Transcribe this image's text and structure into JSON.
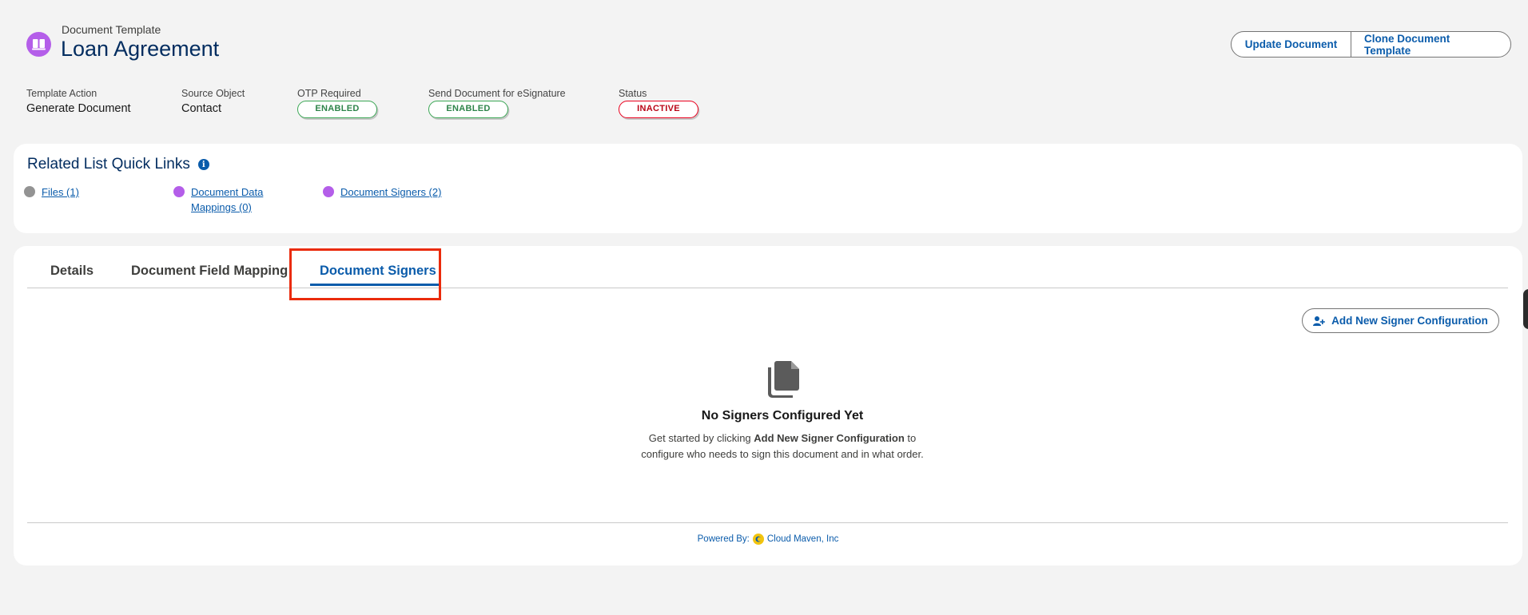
{
  "header": {
    "object_type": "Document Template",
    "title": "Loan Agreement",
    "buttons": {
      "update": "Update Document",
      "clone": "Clone Document Template"
    }
  },
  "fields": [
    {
      "label": "Template Action",
      "value": "Generate Document"
    },
    {
      "label": "Source Object",
      "value": "Contact"
    },
    {
      "label": "OTP Required",
      "badge": "ENABLED"
    },
    {
      "label": "Send Document for eSignature",
      "badge": "ENABLED"
    },
    {
      "label": "Status",
      "badge": "INACTIVE"
    }
  ],
  "quick_links": {
    "title": "Related List Quick Links",
    "links": [
      {
        "label": "Files (1)",
        "icon": "file-icon"
      },
      {
        "label_line1": "Document Data",
        "label_line2": "Mappings (0)",
        "icon": "book-icon"
      },
      {
        "label": "Document Signers (2)",
        "icon": "book-icon"
      }
    ]
  },
  "tabs": [
    {
      "label": "Details"
    },
    {
      "label": "Document Field Mapping"
    },
    {
      "label": "Document Signers",
      "active": true
    }
  ],
  "signers": {
    "add_button": "Add New Signer Configuration",
    "empty_title": "No Signers Configured Yet",
    "empty_desc_pre": "Get started by clicking ",
    "empty_desc_bold": "Add New Signer Configuration",
    "empty_desc_post": " to configure who needs to sign this document and in what order."
  },
  "footer": {
    "powered_label": "Powered By:",
    "company": "Cloud Maven, Inc"
  },
  "colors": {
    "brand_blue": "#0b5cab",
    "title_navy": "#032d60",
    "icon_purple": "#b45ee9",
    "enabled_green": "#2e844a",
    "inactive_red": "#ba0517",
    "highlight": "#ea2b0c"
  }
}
